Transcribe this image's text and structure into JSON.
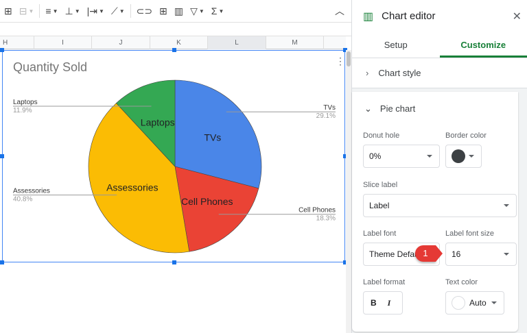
{
  "toolbar": {
    "icons": [
      "borders-icon",
      "merge-icon",
      "align-left-icon",
      "valign-icon",
      "wrap-icon",
      "rotate-icon",
      "link-icon",
      "comment-icon",
      "chart-icon",
      "filter-icon",
      "sum-icon",
      "collapse-icon"
    ]
  },
  "columns": [
    "H",
    "I",
    "J",
    "K",
    "L",
    "M"
  ],
  "chart_data": {
    "type": "pie",
    "title": "Quantity Sold",
    "categories": [
      "TVs",
      "Cell Phones",
      "Assessories",
      "Laptops"
    ],
    "values": [
      29.1,
      18.3,
      40.8,
      11.9
    ],
    "labels": [
      "29.1%",
      "18.3%",
      "40.8%",
      "11.9%"
    ],
    "colors": [
      "#4a86e8",
      "#ea4335",
      "#fbbc04",
      "#34a853"
    ]
  },
  "editor": {
    "title": "Chart editor",
    "tabs": [
      "Setup",
      "Customize"
    ],
    "chart_style": "Chart style",
    "pie_chart": "Pie chart",
    "donut_hole_label": "Donut hole",
    "donut_hole": "0%",
    "border_color_label": "Border color",
    "slice_label_label": "Slice label",
    "slice_label": "Label",
    "label_font_label": "Label font",
    "label_font": "Theme Default",
    "label_font_size_label": "Label font size",
    "label_font_size": "16",
    "label_format_label": "Label format",
    "bold": "B",
    "italic": "I",
    "text_color_label": "Text color",
    "text_color": "Auto",
    "callout": "1"
  }
}
